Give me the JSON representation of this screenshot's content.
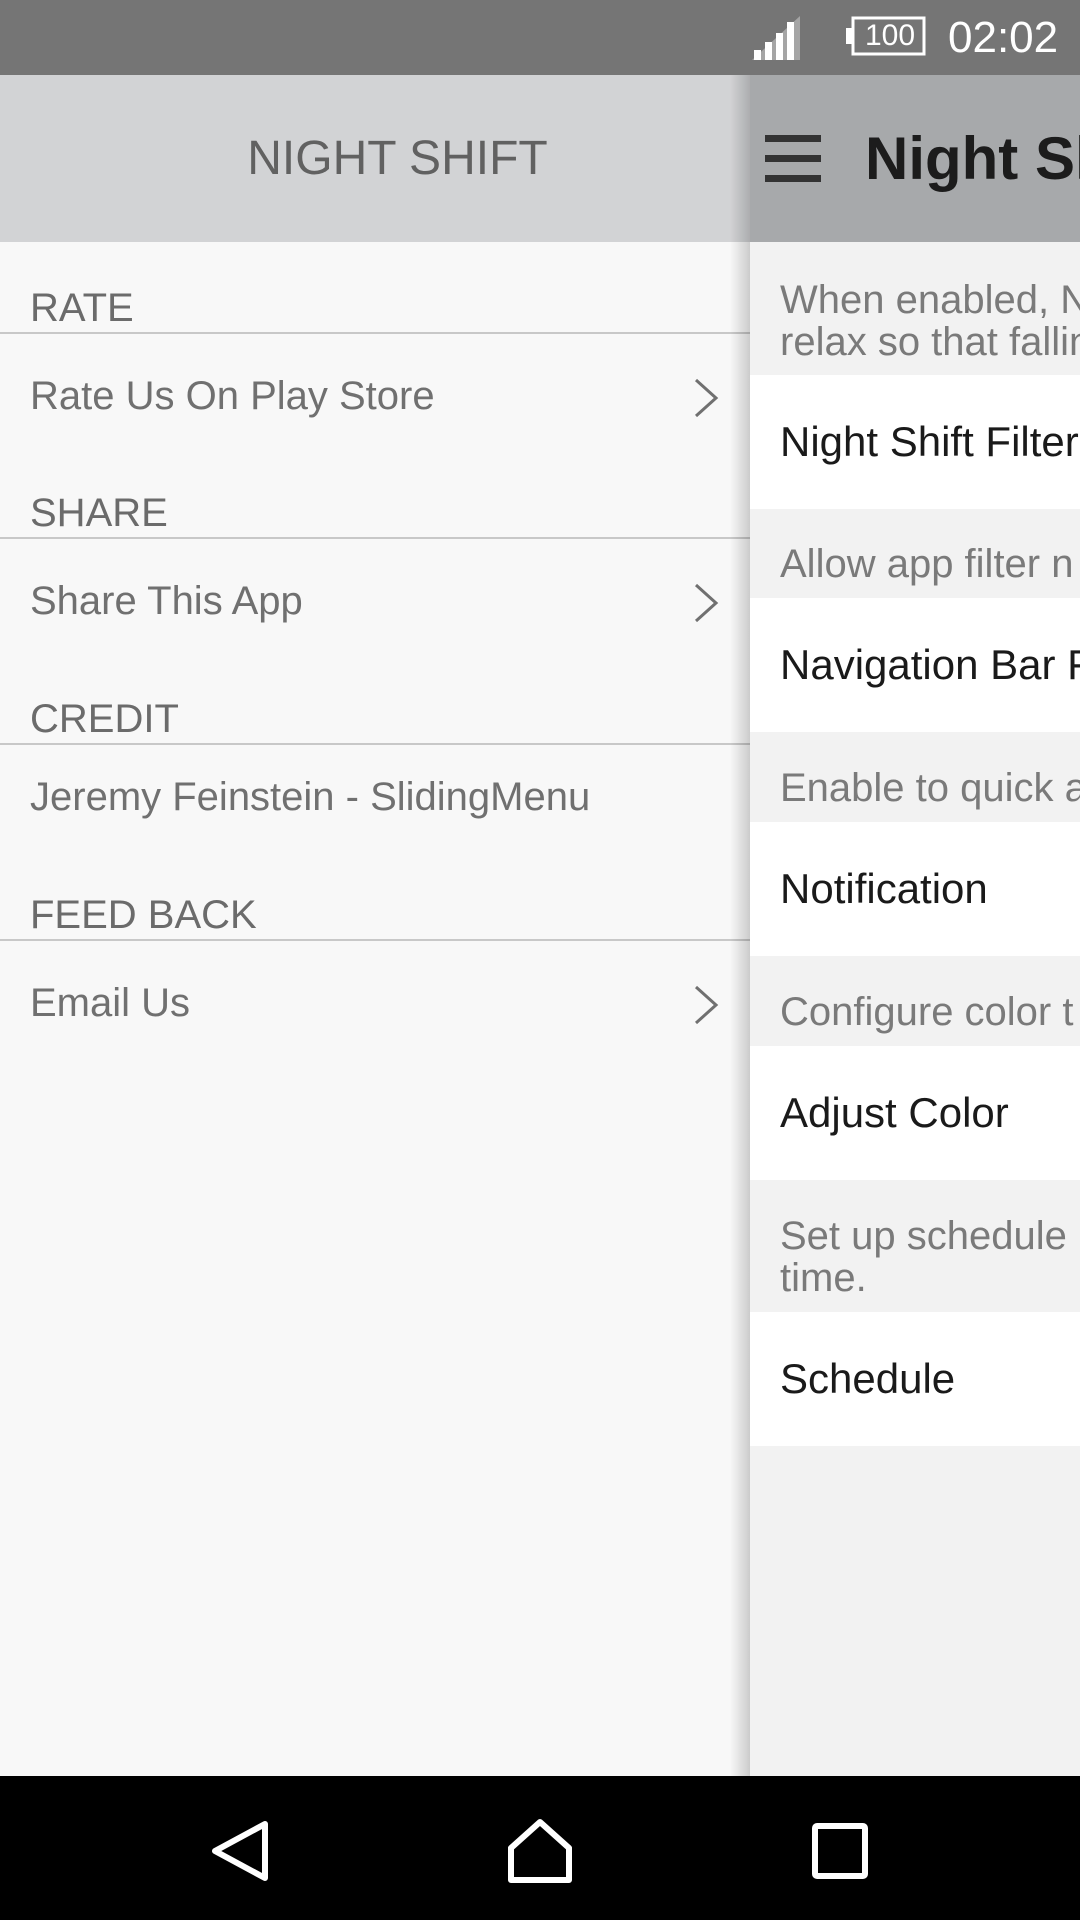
{
  "status_bar": {
    "battery": "100",
    "time": "02:02"
  },
  "menu": {
    "title": "NIGHT SHIFT",
    "sections": [
      {
        "header": "RATE",
        "item": "Rate Us On Play Store",
        "chevron": true
      },
      {
        "header": "SHARE",
        "item": "Share This App",
        "chevron": true
      },
      {
        "header": "CREDIT",
        "item": "Jeremy Feinstein - SlidingMenu",
        "chevron": false
      },
      {
        "header": "FEED BACK",
        "item": "Email Us",
        "chevron": true
      }
    ]
  },
  "main": {
    "title": "Night Sh",
    "descriptions": [
      "When enabled, N",
      "relax so that fallin",
      "Allow app filter n",
      "Enable to quick a",
      "Configure color t",
      "Set up schedule",
      "time."
    ],
    "preferences": [
      "Night Shift Filter",
      "Navigation Bar F",
      "Notification",
      "Adjust Color",
      "Schedule"
    ]
  },
  "colors": {
    "status_bar": "#757575",
    "menu_header": "#d2d3d5",
    "toolbar": "#a7a9ab",
    "nav_bar": "#000000"
  },
  "icons": [
    "cellular-signal-icon",
    "battery-icon",
    "hamburger-menu-icon",
    "chevron-right-icon",
    "back-icon",
    "home-icon",
    "recents-icon"
  ]
}
